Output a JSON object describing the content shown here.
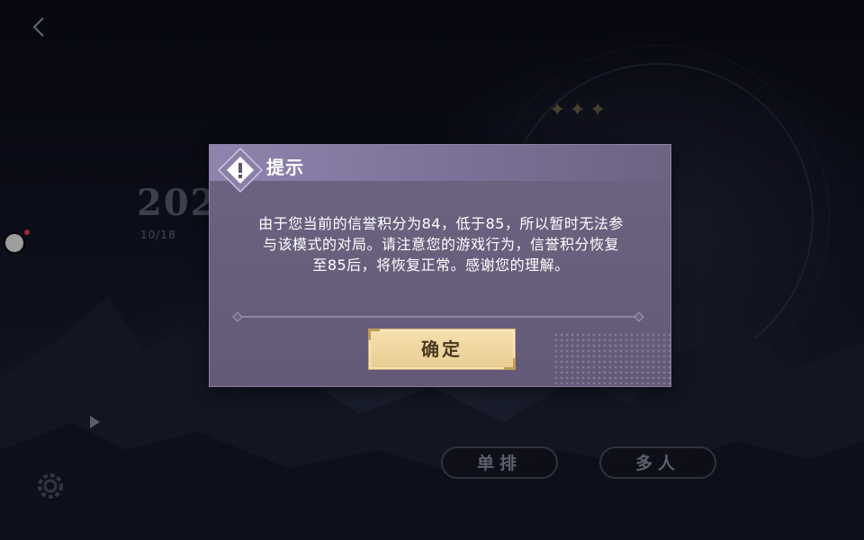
{
  "background": {
    "year_text": "202",
    "date_text": "10/18",
    "stars": "✦✦✦",
    "back_icon": "chevron-left-icon",
    "settings_icon": "gear-icon"
  },
  "modes": {
    "solo_label": "单排",
    "multi_label": "多人"
  },
  "dialog": {
    "title": "提示",
    "icon": "warning-icon",
    "message_lines": [
      "由于您当前的信誉积分为84，低于85，所以暂时无法参",
      "与该模式的对局。请注意您的游戏行为，信誉积分恢复",
      "至85后，将恢复正常。感谢您的理解。"
    ],
    "confirm_label": "确定"
  },
  "colors": {
    "dialog_bg": "#6c6481",
    "confirm_bg": "#f6e0b0",
    "confirm_text": "#4a3a20"
  }
}
